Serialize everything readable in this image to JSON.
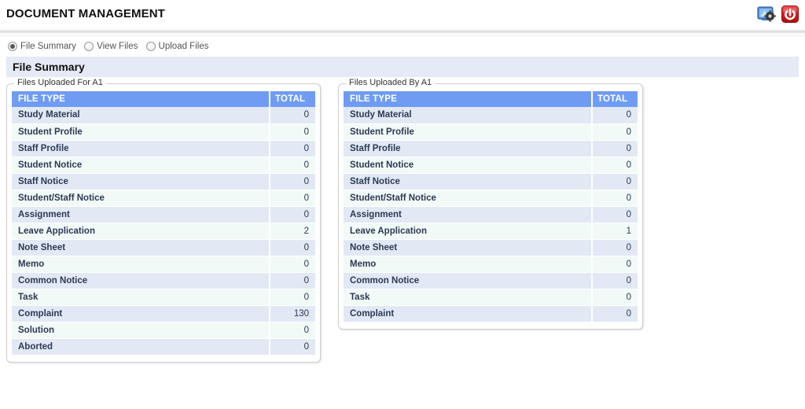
{
  "header": {
    "title": "DOCUMENT MANAGEMENT",
    "icons": [
      {
        "name": "display-settings-icon",
        "label": "Display Settings"
      },
      {
        "name": "power-logout-icon",
        "label": "Logout"
      }
    ]
  },
  "nav": {
    "options": [
      {
        "label": "File Summary",
        "selected": true
      },
      {
        "label": "View Files",
        "selected": false
      },
      {
        "label": "Upload Files",
        "selected": false
      }
    ]
  },
  "section": {
    "title": "File Summary"
  },
  "colors": {
    "table_header_blue": "#6f9cf2",
    "row_odd": "#e2e9f5",
    "row_even": "#f2faf7",
    "section_bar": "#e4eaf6",
    "power_red": "#d81f1f"
  },
  "panels": [
    {
      "legend": "Files Uploaded For A1",
      "columns": [
        "FILE TYPE",
        "TOTAL"
      ],
      "rows": [
        {
          "type": "Study Material",
          "total": "0"
        },
        {
          "type": "Student Profile",
          "total": "0"
        },
        {
          "type": "Staff Profile",
          "total": "0"
        },
        {
          "type": "Student Notice",
          "total": "0"
        },
        {
          "type": "Staff Notice",
          "total": "0"
        },
        {
          "type": "Student/Staff Notice",
          "total": "0"
        },
        {
          "type": "Assignment",
          "total": "0"
        },
        {
          "type": "Leave Application",
          "total": "2"
        },
        {
          "type": "Note Sheet",
          "total": "0"
        },
        {
          "type": "Memo",
          "total": "0"
        },
        {
          "type": "Common Notice",
          "total": "0"
        },
        {
          "type": "Task",
          "total": "0"
        },
        {
          "type": "Complaint",
          "total": "130"
        },
        {
          "type": "Solution",
          "total": "0"
        },
        {
          "type": "Aborted",
          "total": "0"
        }
      ]
    },
    {
      "legend": "Files Uploaded By A1",
      "columns": [
        "FILE TYPE",
        "TOTAL"
      ],
      "rows": [
        {
          "type": "Study Material",
          "total": "0"
        },
        {
          "type": "Student Profile",
          "total": "0"
        },
        {
          "type": "Staff Profile",
          "total": "0"
        },
        {
          "type": "Student Notice",
          "total": "0"
        },
        {
          "type": "Staff Notice",
          "total": "0"
        },
        {
          "type": "Student/Staff Notice",
          "total": "0"
        },
        {
          "type": "Assignment",
          "total": "0"
        },
        {
          "type": "Leave Application",
          "total": "1"
        },
        {
          "type": "Note Sheet",
          "total": "0"
        },
        {
          "type": "Memo",
          "total": "0"
        },
        {
          "type": "Common Notice",
          "total": "0"
        },
        {
          "type": "Task",
          "total": "0"
        },
        {
          "type": "Complaint",
          "total": "0"
        }
      ]
    }
  ]
}
